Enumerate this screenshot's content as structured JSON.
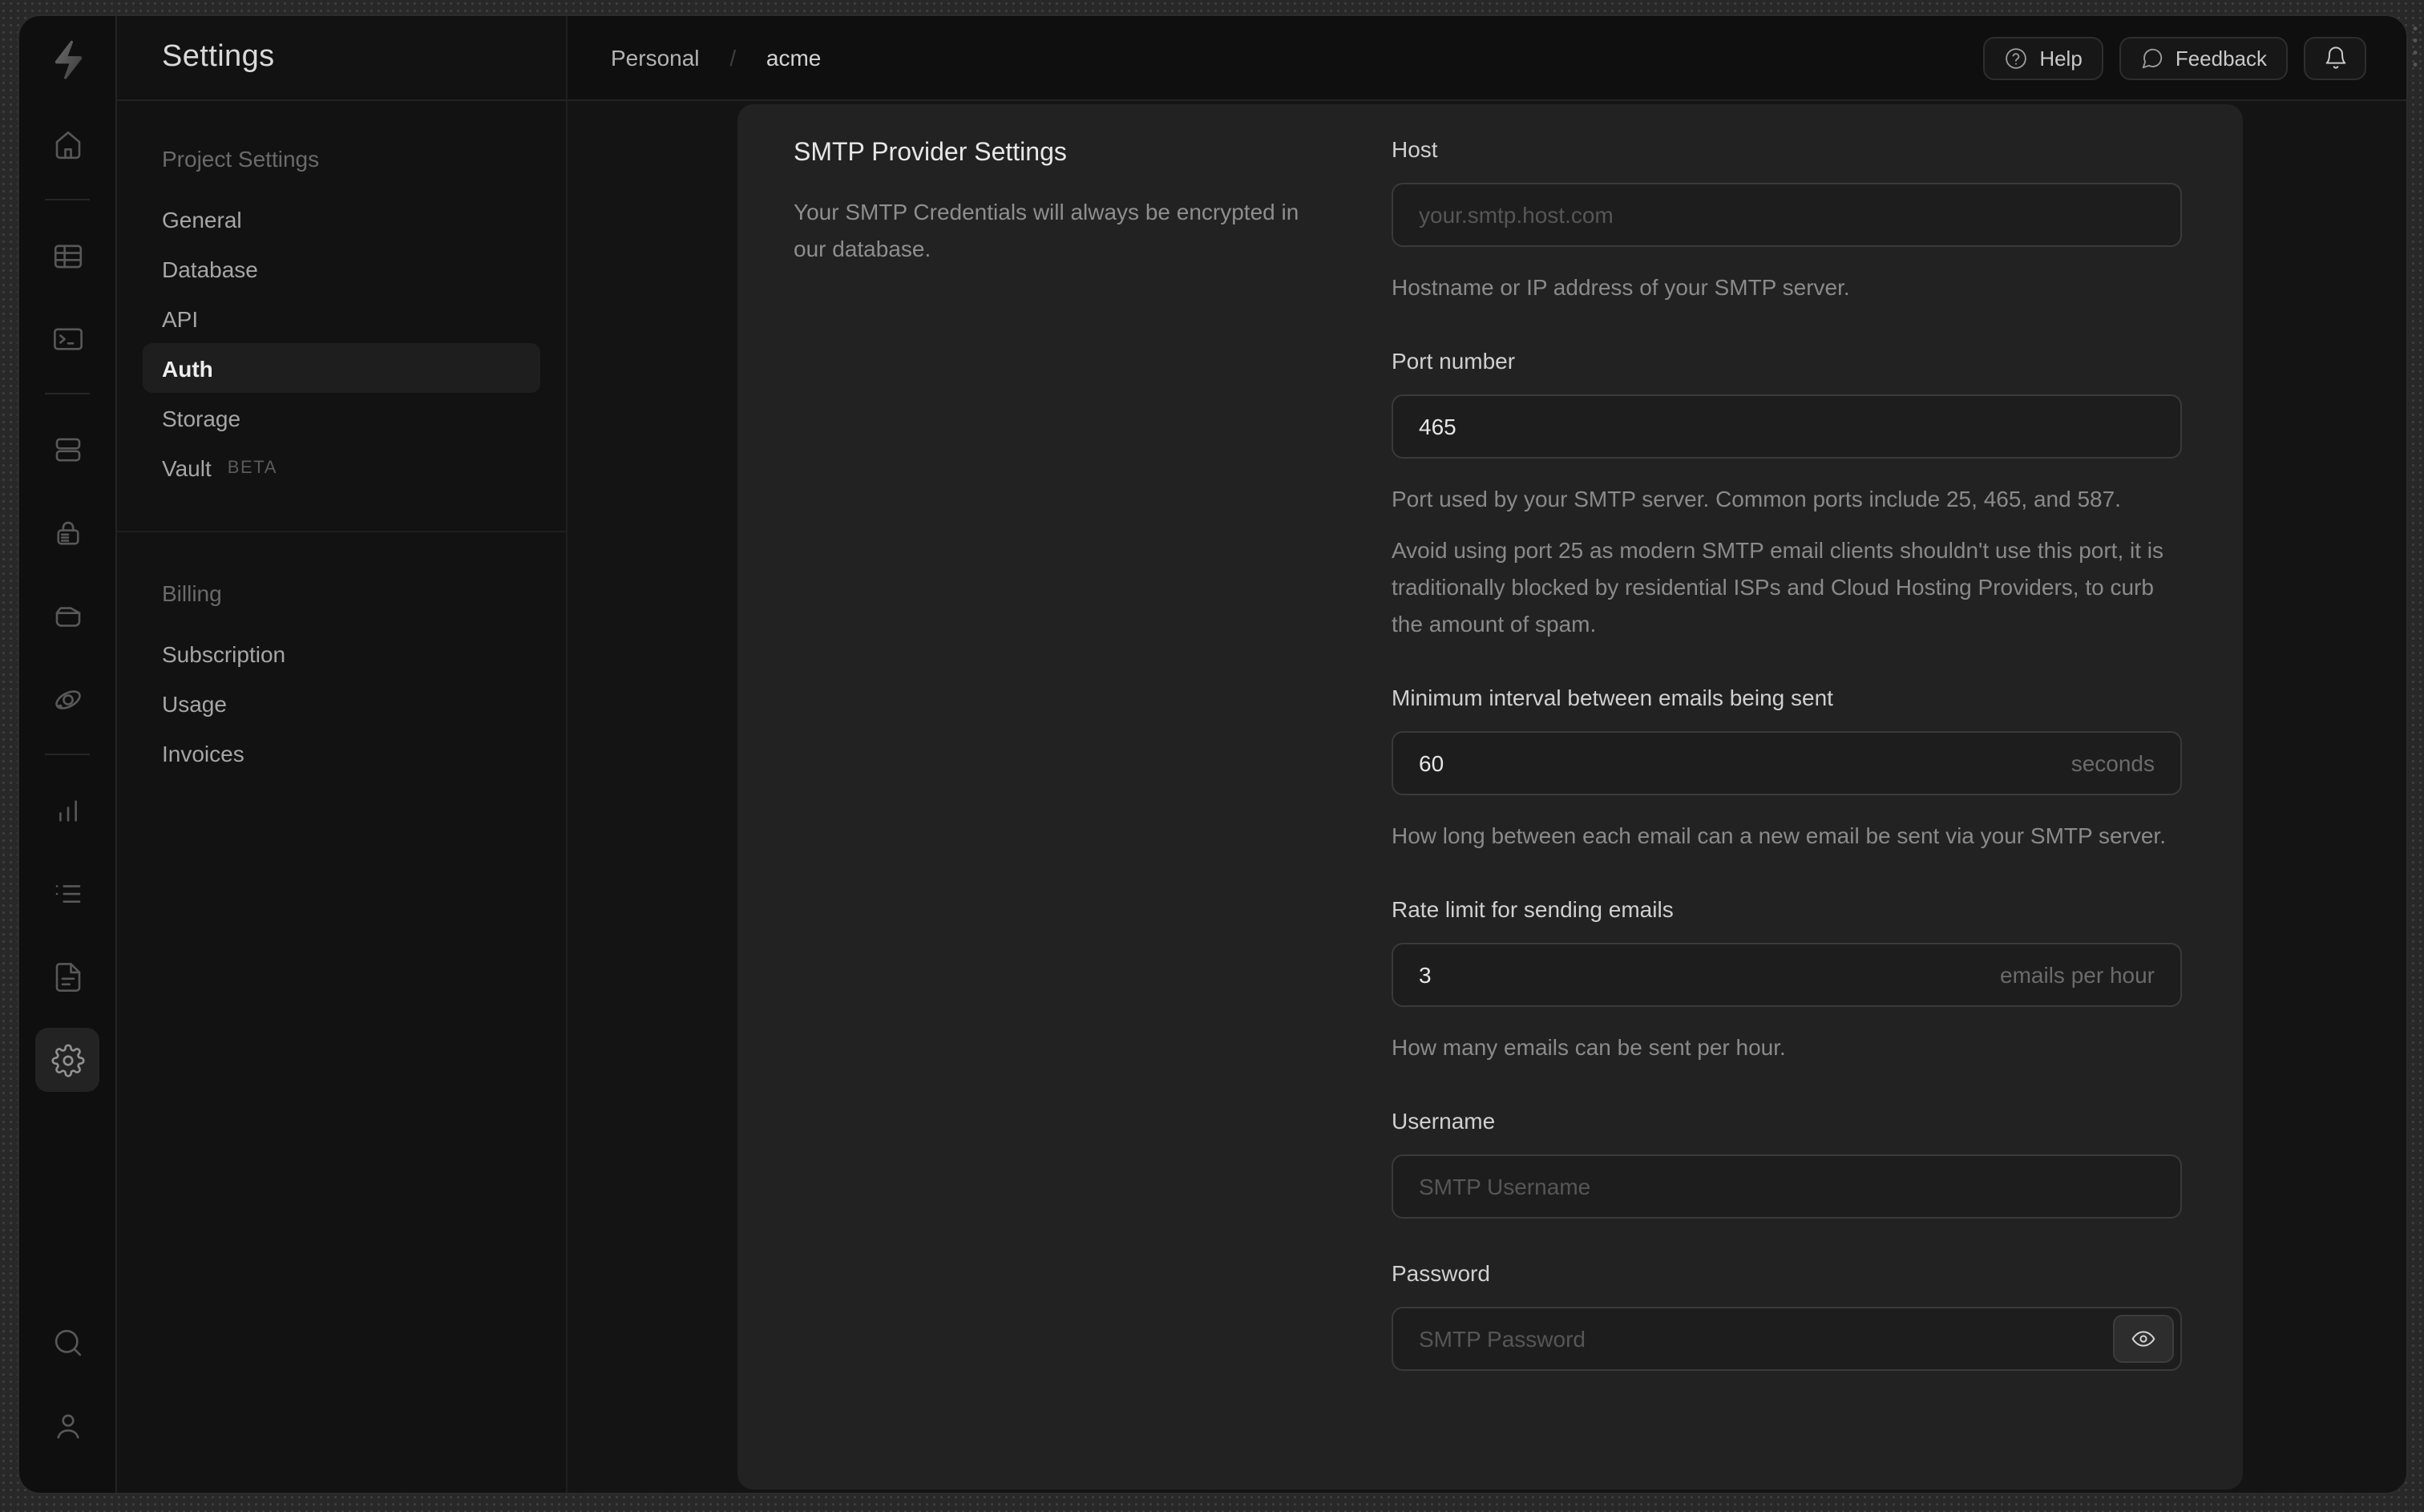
{
  "colors": {
    "outer_bg": "#282828",
    "window_bg": "#0f0f0f",
    "content_bg": "#141414",
    "panel_bg": "#222222",
    "input_bg": "#1d1d1d",
    "input_border": "#3a3a3a",
    "active_row_bg": "#1e1e1e"
  },
  "rail": {
    "logo": "supabase-logo",
    "items": [
      "home",
      "table-editor",
      "sql-editor",
      "database",
      "authentication",
      "storage",
      "edge-functions",
      "reports",
      "logs",
      "docs",
      "project-settings",
      "search",
      "profile"
    ],
    "active_item": "project-settings"
  },
  "sidebar": {
    "title": "Settings",
    "sections": [
      {
        "label": "Project Settings",
        "items": [
          {
            "label": "General"
          },
          {
            "label": "Database"
          },
          {
            "label": "API"
          },
          {
            "label": "Auth",
            "active": true
          },
          {
            "label": "Storage"
          },
          {
            "label": "Vault",
            "badge": "BETA"
          }
        ]
      },
      {
        "label": "Billing",
        "items": [
          {
            "label": "Subscription"
          },
          {
            "label": "Usage"
          },
          {
            "label": "Invoices"
          }
        ]
      }
    ]
  },
  "topbar": {
    "breadcrumb": {
      "org": "Personal",
      "separator": "/",
      "project": "acme"
    },
    "help_label": "Help",
    "feedback_label": "Feedback"
  },
  "panel": {
    "title": "SMTP Provider Settings",
    "description": "Your SMTP Credentials will always be encrypted in our database.",
    "fields": [
      {
        "label": "Host",
        "placeholder": "your.smtp.host.com",
        "help": [
          "Hostname or IP address of your SMTP server."
        ]
      },
      {
        "label": "Port number",
        "value": "465",
        "help": [
          "Port used by your SMTP server. Common ports include 25, 465, and 587.",
          "Avoid using port 25 as modern SMTP email clients shouldn't use this port, it is traditionally blocked by residential ISPs and Cloud Hosting Providers, to curb the amount of spam."
        ]
      },
      {
        "label": "Minimum interval between emails being sent",
        "value": "60",
        "suffix": "seconds",
        "help": [
          "How long between each email can a new email be sent via your SMTP server."
        ]
      },
      {
        "label": "Rate limit for sending emails",
        "value": "3",
        "suffix": "emails per hour",
        "help": [
          "How many emails can be sent per hour."
        ]
      },
      {
        "label": "Username",
        "placeholder": "SMTP Username"
      },
      {
        "label": "Password",
        "placeholder": "SMTP Password"
      }
    ]
  }
}
